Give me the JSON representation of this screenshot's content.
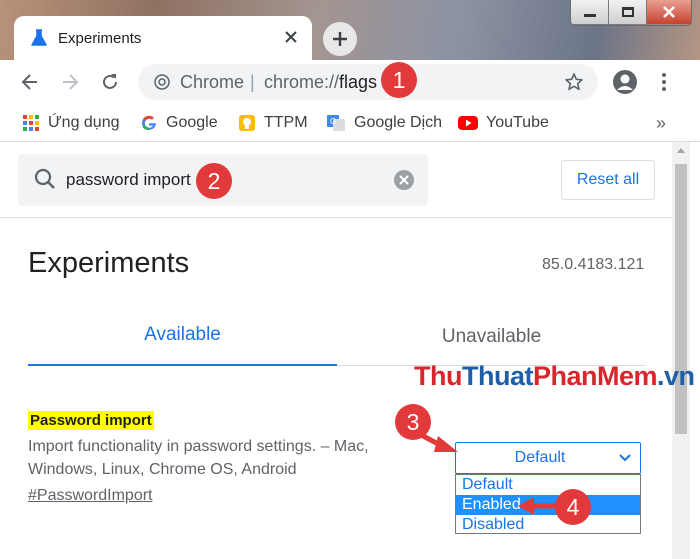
{
  "tab": {
    "title": "Experiments"
  },
  "omnibox": {
    "scheme_label": "Chrome",
    "separator": "|",
    "url_prefix": "chrome://",
    "url_bold": "flags"
  },
  "bookmarks": [
    {
      "label": "Ứng dụng",
      "icon": "apps-grid-icon"
    },
    {
      "label": "Google",
      "icon": "google-icon"
    },
    {
      "label": "TTPM",
      "icon": "bulb-icon"
    },
    {
      "label": "Google Dịch",
      "icon": "translate-icon"
    },
    {
      "label": "YouTube",
      "icon": "youtube-icon"
    }
  ],
  "bookmarks_more": "»",
  "search": {
    "value": "password import"
  },
  "reset_label": "Reset all",
  "page": {
    "title": "Experiments",
    "version": "85.0.4183.121"
  },
  "tabs": {
    "available": "Available",
    "unavailable": "Unavailable"
  },
  "watermark": {
    "part1": "Thu",
    "part2": "Thuat",
    "part3": "PhanMem",
    "part4": ".vn"
  },
  "flag": {
    "name": "Password import",
    "description": "Import functionality in password settings. – Mac, Windows, Linux, Chrome OS, Android",
    "link": "#PasswordImport",
    "selected": "Default",
    "options": [
      "Default",
      "Enabled",
      "Disabled"
    ],
    "highlighted_option": "Enabled"
  },
  "steps": [
    "1",
    "2",
    "3",
    "4"
  ],
  "colors": {
    "accent": "#1a73e8",
    "badge": "#e23a3a",
    "highlight": "#ffff00",
    "dropdown_selected": "#1e90ff"
  }
}
